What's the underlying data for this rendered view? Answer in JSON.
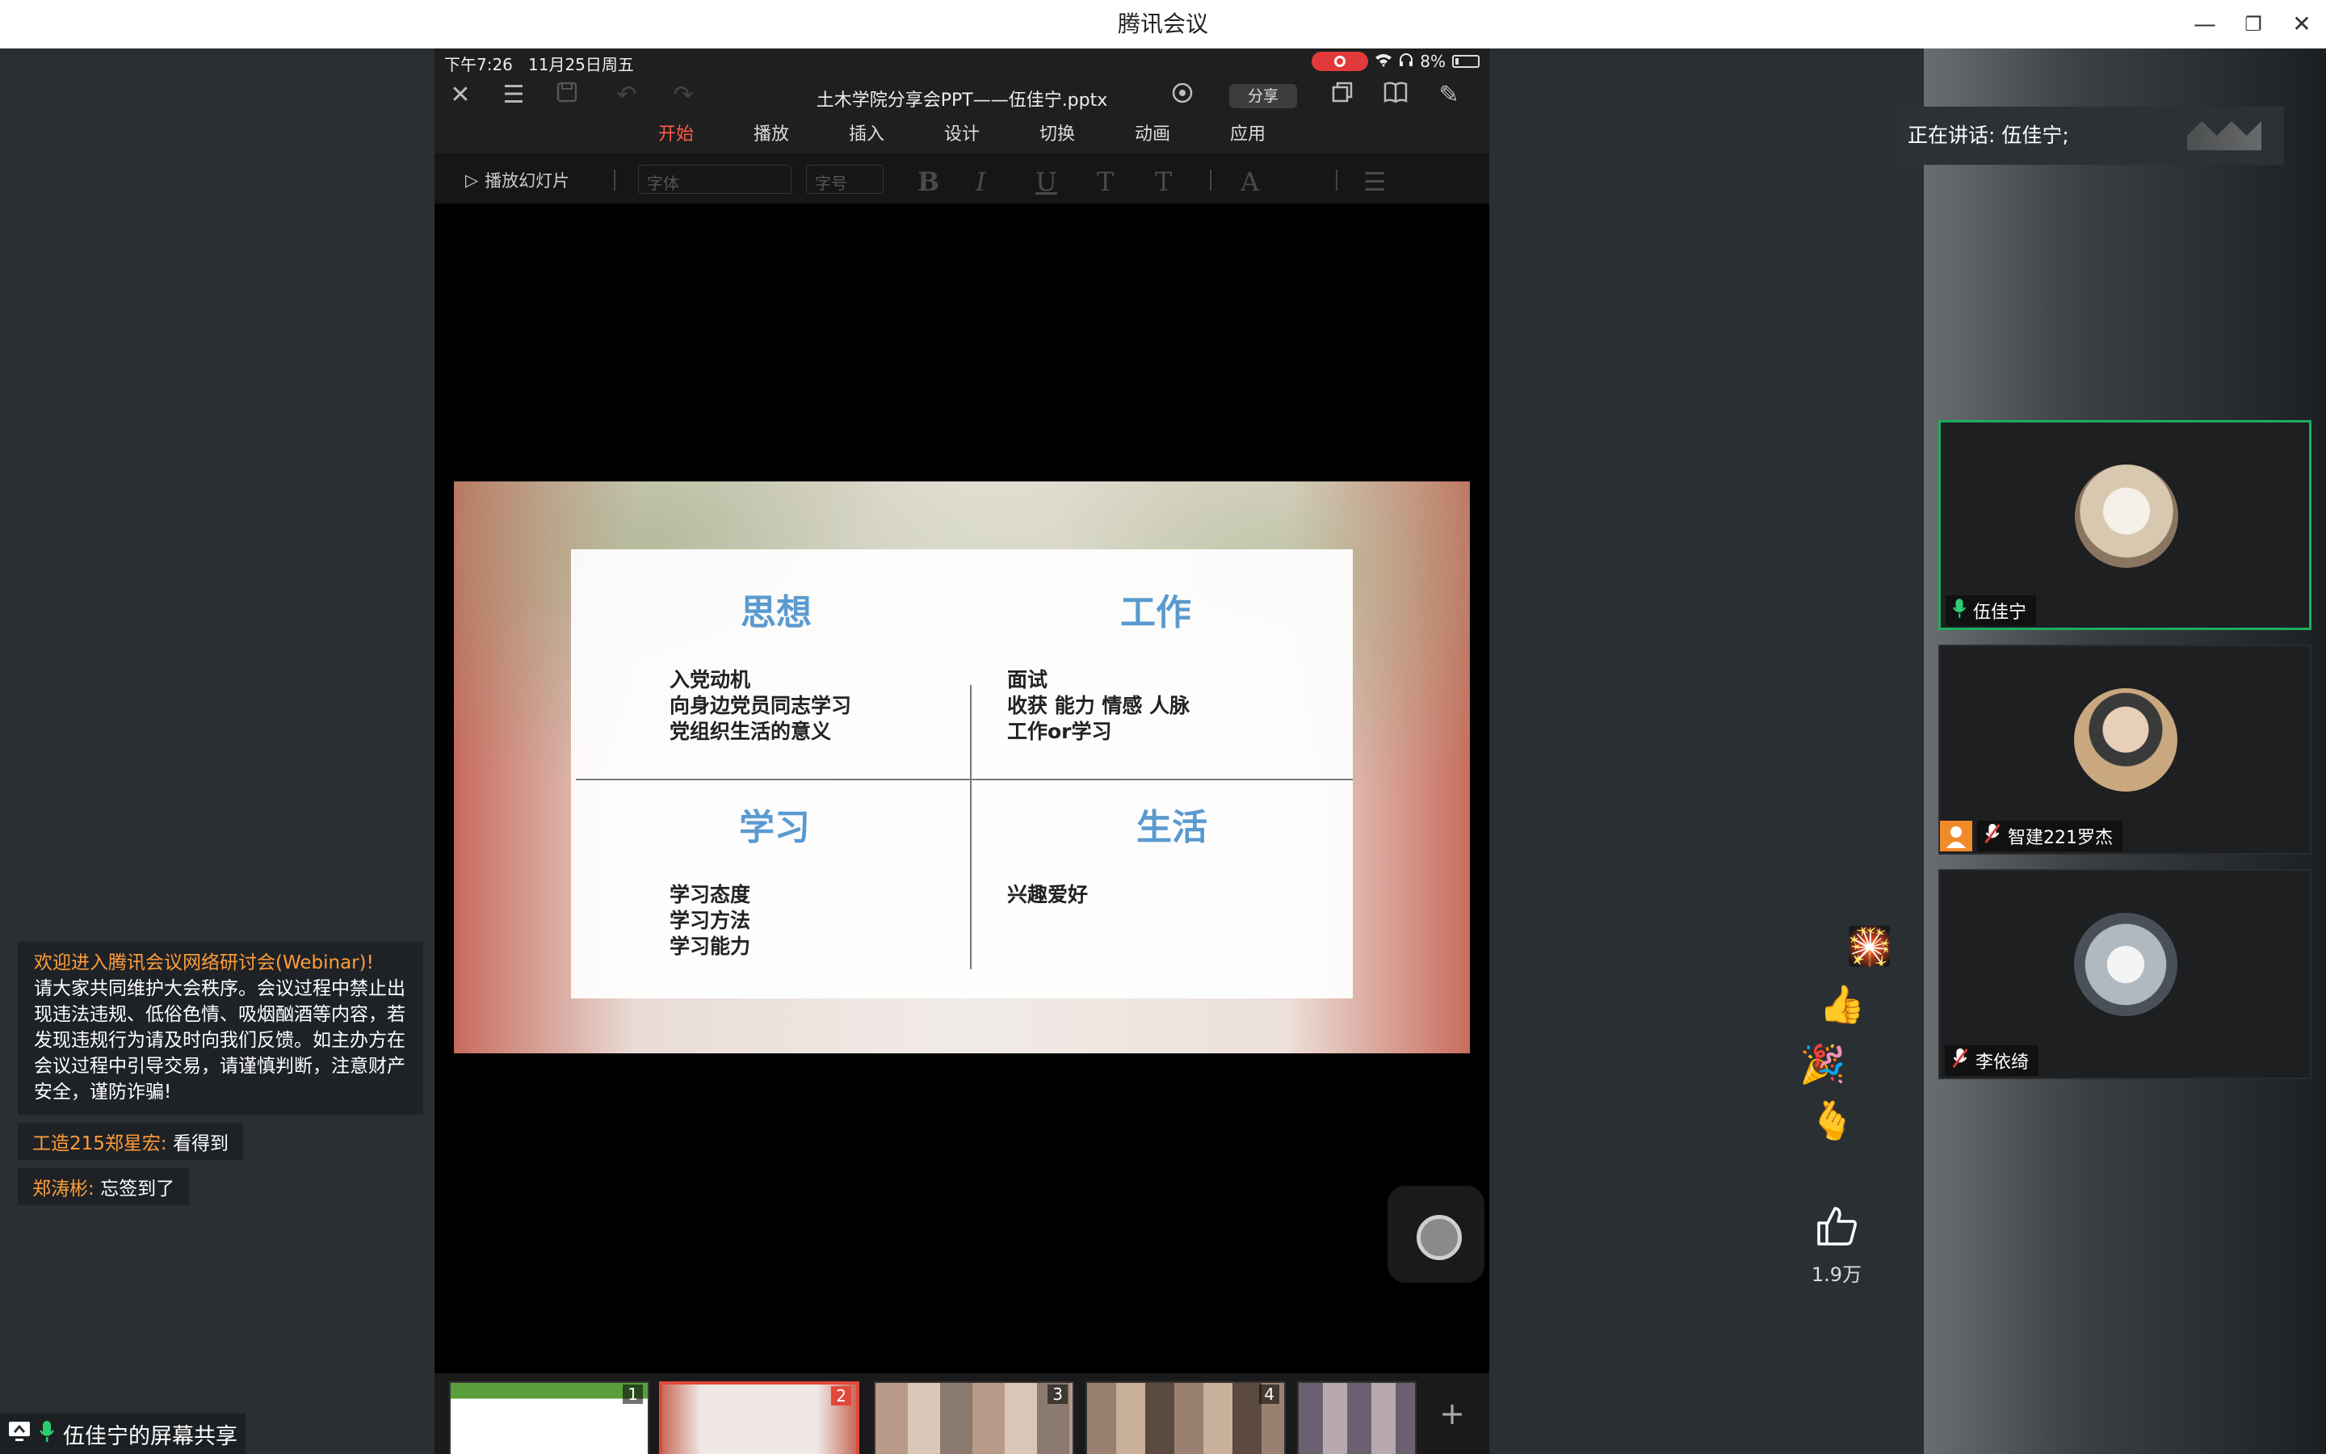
{
  "window": {
    "title": "腾讯会议",
    "controls": {
      "minimize": "—",
      "restore": "❐",
      "close": "✕"
    }
  },
  "ipad": {
    "status": {
      "time": "下午7:26",
      "date": "11月25日周五",
      "battery": "8%"
    },
    "doc_title": "土木学院分享会PPT——伍佳宁.pptx",
    "share_label": "分享",
    "menu": [
      "开始",
      "播放",
      "插入",
      "设计",
      "切换",
      "动画",
      "应用"
    ],
    "active_menu": "开始",
    "ribbon": {
      "play_label": "播放幻灯片",
      "font_placeholder": "字体",
      "size_placeholder": "字号"
    }
  },
  "slide": {
    "quadrants": [
      {
        "title": "思想",
        "lines": [
          "入党动机",
          "向身边党员同志学习",
          "党组织生活的意义"
        ]
      },
      {
        "title": "工作",
        "lines": [
          "面试",
          "收获 能力 情感 人脉",
          "工作or学习"
        ]
      },
      {
        "title": "学习",
        "lines": [
          "学习态度",
          "学习方法",
          "学习能力"
        ]
      },
      {
        "title": "生活",
        "lines": [
          "兴趣爱好"
        ]
      }
    ]
  },
  "thumbnails": [
    {
      "num": "1",
      "label": "",
      "active": false
    },
    {
      "num": "2",
      "label": "",
      "active": true
    },
    {
      "num": "3",
      "label": "",
      "active": false
    },
    {
      "num": "4",
      "label": "",
      "active": false
    },
    {
      "num": "",
      "label": "",
      "active": false
    }
  ],
  "thumb_tools": {
    "add": "+",
    "grid": "☷"
  },
  "chat": {
    "notice_title": "欢迎进入腾讯会议网络研讨会(Webinar)!",
    "notice_body": "请大家共同维护大会秩序。会议过程中禁止出现违法违规、低俗色情、吸烟酗酒等内容，若发现违规行为请及时向我们反馈。如主办方在会议过程中引导交易，请谨慎判断，注意财产安全，谨防诈骗!",
    "messages": [
      {
        "sender": "工造215郑星宏:",
        "text": "看得到"
      },
      {
        "sender": "郑涛彬:",
        "text": "忘签到了"
      }
    ]
  },
  "screen_share_label": "伍佳宁的屏幕共享",
  "speaking": {
    "label": "正在讲话: 伍佳宁;"
  },
  "participants": [
    {
      "name": "伍佳宁",
      "mic": "on",
      "active": true
    },
    {
      "name": "智建221罗杰",
      "mic": "off",
      "host": true
    },
    {
      "name": "李依绮",
      "mic": "off"
    }
  ],
  "like": {
    "count": "1.9万"
  },
  "colors": {
    "accent_red": "#e0493a",
    "chat_highlight": "#ff9e3a",
    "active_border": "#1cae5e",
    "slide_title": "#5a9ad0"
  }
}
